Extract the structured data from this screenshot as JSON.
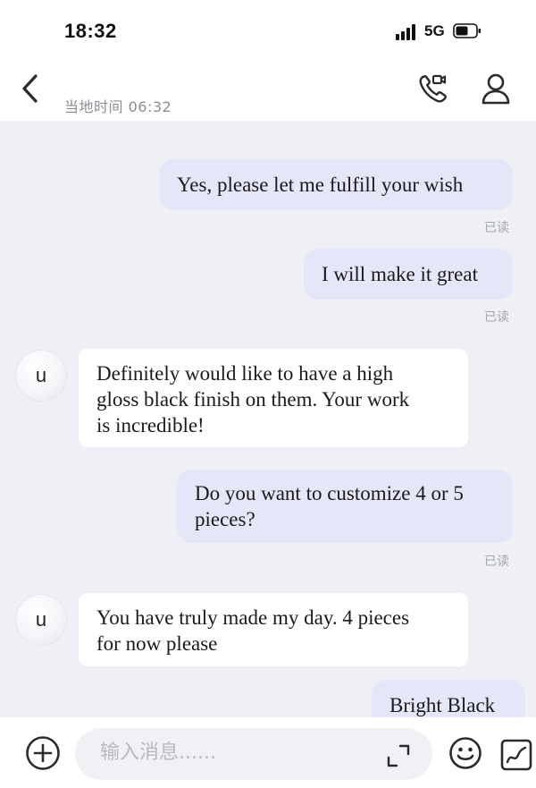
{
  "status_bar": {
    "time": "18:32",
    "network": "5G"
  },
  "header": {
    "local_time": "当地时间 06:32",
    "icons": {
      "back": "back-chevron-icon",
      "call": "video-call-icon",
      "profile": "person-icon"
    }
  },
  "messages": [
    {
      "direction": "out",
      "lines": [
        "Yes, please let me fulfill your wish"
      ],
      "read_label": "已读"
    },
    {
      "direction": "out",
      "lines": [
        "I will make it great"
      ],
      "read_label": "已读"
    },
    {
      "direction": "in",
      "avatar": "u",
      "lines": [
        "Definitely would like to have a high",
        "gloss black finish on them.  Your work",
        "is incredible!"
      ]
    },
    {
      "direction": "out",
      "lines": [
        "Do you want to customize 4 or 5",
        "pieces?"
      ],
      "read_label": "已读"
    },
    {
      "direction": "in",
      "avatar": "u",
      "lines": [
        "You have truly made my day.  4 pieces",
        "for now please"
      ]
    },
    {
      "direction": "out",
      "lines": [
        "Bright Black"
      ]
    }
  ],
  "input_bar": {
    "placeholder": "输入消息......",
    "icons": {
      "add": "plus-circle-icon",
      "expand": "expand-icon",
      "emoji": "emoji-icon",
      "quick": "quick-reply-icon"
    }
  },
  "colors": {
    "outgoing_bubble": "#e6e6f9",
    "incoming_bubble": "#ffffff",
    "chat_background": "#eff0f5",
    "read_label": "#a3a6ad"
  }
}
